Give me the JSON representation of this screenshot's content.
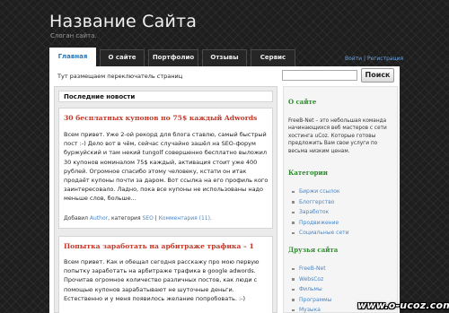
{
  "site": {
    "title": "Название Сайта",
    "slogan": "Слоган сайта."
  },
  "nav": {
    "tabs": [
      {
        "label": "Главная",
        "active": true
      },
      {
        "label": "О сайте",
        "active": false
      },
      {
        "label": "Портфолио",
        "active": false
      },
      {
        "label": "Отзывы",
        "active": false
      },
      {
        "label": "Сервис",
        "active": false
      }
    ],
    "login_label": "Войти",
    "separator": " | ",
    "register_label": "Регистрация"
  },
  "topbar": {
    "switch_text": "Тут размещаем переключатель страниц",
    "search_placeholder": "",
    "search_button": "Поиск"
  },
  "main": {
    "news_heading": "Последние новости",
    "posts": [
      {
        "title": "30 бесплатных купонов по 75$ каждый Adwords",
        "body": "Всем привет. Уже 2-ой рекорд для блога ставлю, самый быстрый пост :-) Дело вот в чём, сейчас случайно зашёл на SEO-форум буржуйский и там некий tungolf совершенно бесплатно выложил 30 купонов номиналом 75$ каждый, активация стоит уже 400 рублей. Огромное спасибо этому человеку, кстати он итак продаёт купоны почти за даром. Вот ссылка на его профиль кого заинтересовало. Ладно, пока все купоны не использованы надо меньше слов, больше...",
        "meta": {
          "added_prefix": "Добавил ",
          "author": "Author",
          "category_prefix": ", категория ",
          "category": "SEO",
          "comments_sep": " | ",
          "comments": "Комментария (11)",
          "end": "."
        }
      },
      {
        "title": "Попытка заработать на арбитраже трафика – 1",
        "body": "Всем привет. Как и обещал сегодня расскажу про мою первую попытку заработать на арбитраже трафика в google adwords. Прочитав огромное количество различных постов, как люди с помощью купонов зарабатывают не шуточные деньги. Естественно и у меня появилось желание попробовать. :-)"
      }
    ]
  },
  "sidebar": {
    "about": {
      "heading": "О сайте",
      "text": "FreeB-Net – это небольшая команда начинающихся веб мастеров с сети хостинга uCoz. Которые готовы предложить Вам свои услуги по весьма низким ценам."
    },
    "categories": {
      "heading": "Категории",
      "items": [
        "Биржи ссылок",
        "Блоггерство",
        "Заработок",
        "Продвижение",
        "Социальные сети"
      ]
    },
    "friends": {
      "heading": "Друзья сайта",
      "items": [
        "FreeB-Net",
        "WebsCoz",
        "Фильмы",
        "Программы",
        "Музыка"
      ]
    }
  },
  "watermark": {
    "text": "www.o-ucoz.com"
  }
}
